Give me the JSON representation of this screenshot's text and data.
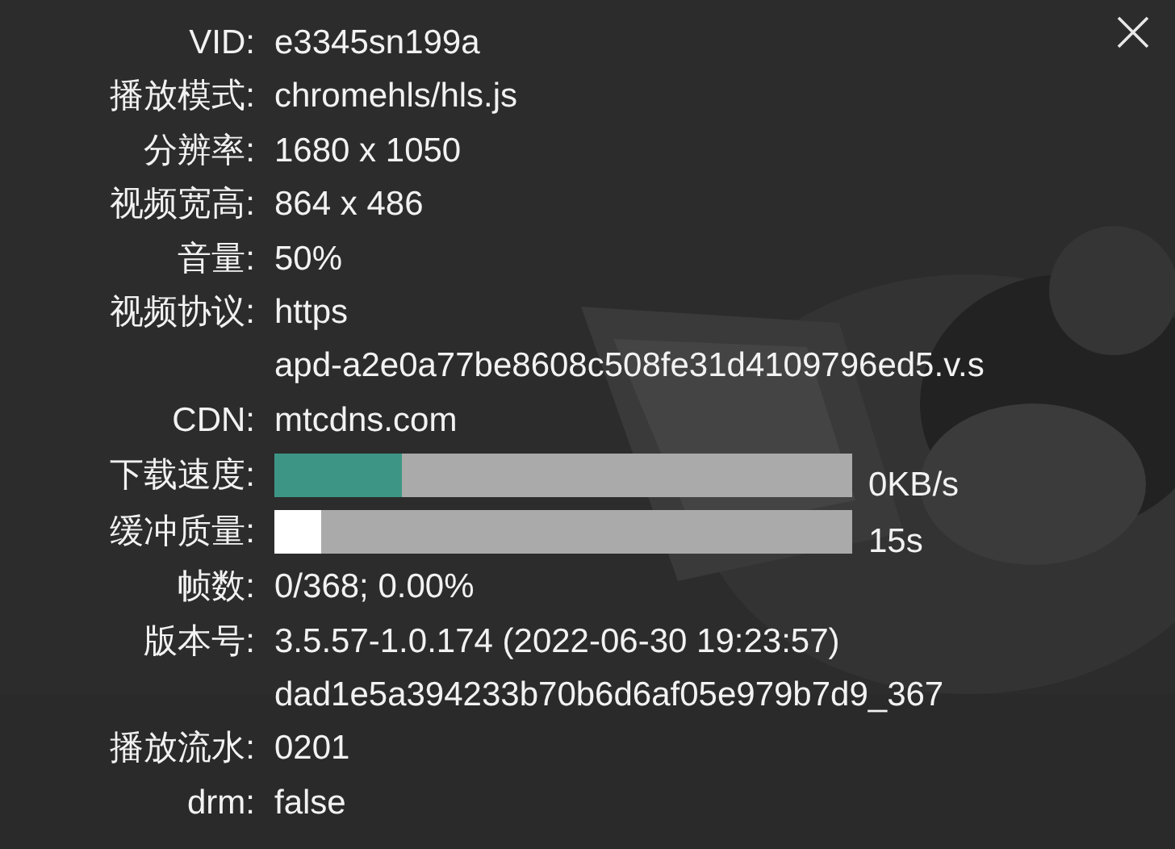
{
  "rows": [
    {
      "kind": "text",
      "label": "VID:",
      "lines": [
        "e3345sn199a"
      ]
    },
    {
      "kind": "text",
      "label": "播放模式:",
      "lines": [
        "chromehls/hls.js"
      ]
    },
    {
      "kind": "text",
      "label": "分辨率:",
      "lines": [
        "1680 x 1050"
      ]
    },
    {
      "kind": "text",
      "label": "视频宽高:",
      "lines": [
        "864 x 486"
      ]
    },
    {
      "kind": "text",
      "label": "音量:",
      "lines": [
        "50%"
      ]
    },
    {
      "kind": "text",
      "label": "视频协议:",
      "lines": [
        "https",
        "apd-a2e0a77be8608c508fe31d4109796ed5.v.s"
      ]
    },
    {
      "kind": "text",
      "label": "CDN:",
      "lines": [
        "mtcdns.com"
      ]
    },
    {
      "kind": "bar",
      "label": "下载速度:",
      "level": 0.22,
      "color": "#3d9685",
      "reading": "0KB/s"
    },
    {
      "kind": "bar",
      "label": "缓冲质量:",
      "level": 0.08,
      "color": "#ffffff",
      "reading": "15s"
    },
    {
      "kind": "text",
      "label": "帧数:",
      "lines": [
        "0/368; 0.00%"
      ]
    },
    {
      "kind": "text",
      "label": "版本号:",
      "lines": [
        "3.5.57-1.0.174 (2022-06-30 19:23:57)",
        "dad1e5a394233b70b6d6af05e979b7d9_367"
      ]
    },
    {
      "kind": "text",
      "label": "播放流水:",
      "lines": [
        "0201"
      ]
    },
    {
      "kind": "text",
      "label": "drm:",
      "lines": [
        "false"
      ]
    }
  ]
}
